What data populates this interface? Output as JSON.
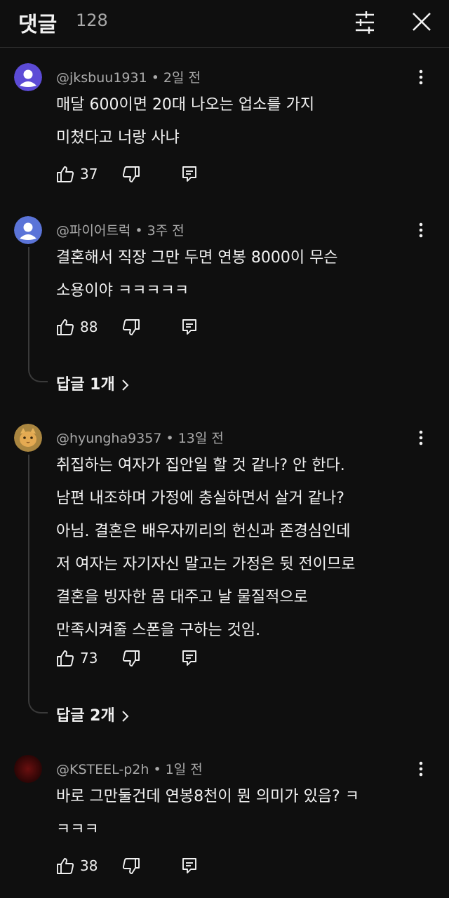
{
  "header": {
    "title": "댓글",
    "count": "128"
  },
  "comments": [
    {
      "author": "@jksbuu1931",
      "time": "2일 전",
      "lines": [
        "매달 600이면 20대 나오는 업소를 가지",
        "미쳤다고 너랑 사냐"
      ],
      "likes": "37",
      "avatar_color": "#5c4bd6"
    },
    {
      "author": "@파이어트럭",
      "time": "3주 전",
      "lines": [
        "결혼해서 직장 그만 두면 연봉 8000이 무슨",
        "소용이야 ㅋㅋㅋㅋㅋ"
      ],
      "likes": "88",
      "avatar_color": "#5b74d8",
      "replies": "답글 1개"
    },
    {
      "author": "@hyungha9357",
      "time": "13일 전",
      "lines": [
        "취집하는 여자가 집안일 할 것 같나? 안 한다.",
        "남편 내조하며 가정에 충실하면서 살거 같나?",
        "아님. 결혼은 배우자끼리의 헌신과 존경심인데",
        "저 여자는 자기자신 말고는 가정은 뒷 전이므로",
        "결혼을 빙자한 몸 대주고 날 물질적으로",
        "만족시켜줄 스폰을 구하는 것임."
      ],
      "likes": "73",
      "avatar_color": "#d9a84a",
      "replies": "답글 2개"
    },
    {
      "author": "@KSTEEL-p2h",
      "time": "1일 전",
      "lines": [
        "바로 그만둘건데 연봉8천이 뭔 의미가 있음? ㅋ",
        "ㅋㅋㅋ"
      ],
      "likes": "38",
      "avatar_color": "#4a0a0a"
    }
  ]
}
